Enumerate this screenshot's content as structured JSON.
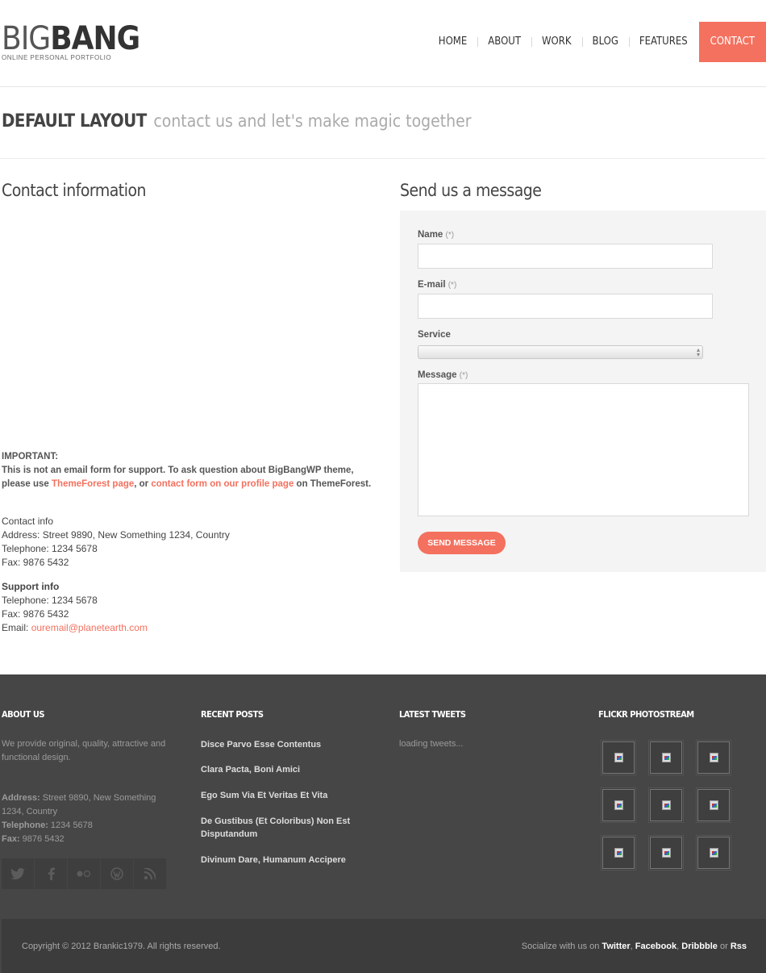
{
  "header": {
    "logo_part1": "BIG",
    "logo_part2": "BANG",
    "tagline": "ONLINE PERSONAL PORTFOLIO",
    "nav": [
      "HOME",
      "ABOUT",
      "WORK",
      "BLOG",
      "FEATURES",
      "CONTACT"
    ],
    "active_nav": "CONTACT",
    "accent_color": "#f4715f"
  },
  "page_title": {
    "strong": "DEFAULT LAYOUT",
    "light": "contact us and let's make magic together"
  },
  "contact": {
    "heading": "Contact information",
    "important_title": "IMPORTANT:",
    "important_text1": "This is not an email form for support. To ask question about BigBangWP theme, please use ",
    "important_link1": "ThemeForest page",
    "important_text2": ", or ",
    "important_link2": "contact form on our profile page",
    "important_text3": " on ThemeForest.",
    "contact_info": {
      "title": "Contact info",
      "address": "Address: Street 9890, New Something 1234, Country",
      "telephone": "Telephone: 1234 5678",
      "fax": "Fax: 9876 5432"
    },
    "support_info": {
      "title": "Support info",
      "telephone": "Telephone: 1234 5678",
      "fax": "Fax: 9876 5432",
      "email_label": "Email: ",
      "email": "ouremail@planetearth.com"
    }
  },
  "form": {
    "heading": "Send us a message",
    "name_label": "Name",
    "email_label": "E-mail",
    "service_label": "Service",
    "message_label": "Message",
    "required_mark": "(*)",
    "name_value": "",
    "email_value": "",
    "service_value": "",
    "message_value": "",
    "submit_label": "SEND MESSAGE"
  },
  "footer": {
    "about": {
      "heading": "ABOUT US",
      "text": "We provide original, quality, attractive and functional design.",
      "address_label": "Address:",
      "address": " Street 9890, New Something 1234, Country",
      "telephone_label": "Telephone:",
      "telephone": " 1234 5678",
      "fax_label": "Fax:",
      "fax": " 9876 5432",
      "social_icons": [
        "twitter-icon",
        "facebook-icon",
        "flickr-icon",
        "wordpress-icon",
        "rss-icon"
      ]
    },
    "recent_posts": {
      "heading": "RECENT POSTS",
      "posts": [
        "Disce Parvo Esse Contentus",
        "Clara Pacta, Boni Amici",
        "Ego Sum Via Et Veritas Et Vita",
        "De Gustibus (Et Coloribus) Non Est Disputandum",
        "Divinum Dare, Humanum Accipere"
      ]
    },
    "tweets": {
      "heading": "LATEST TWEETS",
      "status": "loading tweets..."
    },
    "flickr": {
      "heading": "FLICKR PHOTOSTREAM",
      "photo_count": 9
    },
    "copyright": "Copyright © 2012 Brankic1979. All rights reserved.",
    "socialize_prefix": "Socialize with us on ",
    "socialize_links": [
      "Twitter",
      "Facebook",
      "Dribbble",
      "Rss"
    ],
    "socialize_or": " or "
  }
}
